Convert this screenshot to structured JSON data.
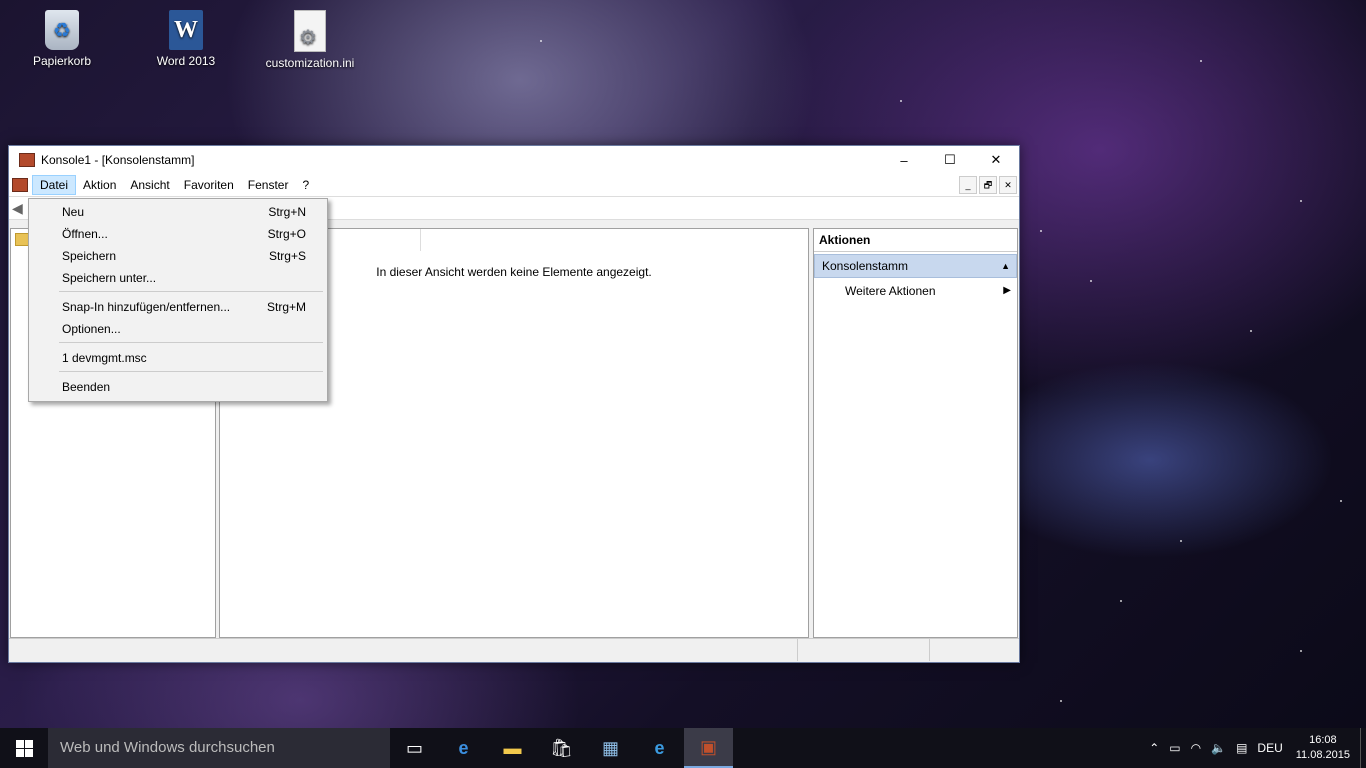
{
  "desktop": {
    "icons": [
      {
        "label": "Papierkorb"
      },
      {
        "label": "Word 2013"
      },
      {
        "label": "customization.ini"
      }
    ]
  },
  "window": {
    "title": "Konsole1 - [Konsolenstamm]",
    "controls": {
      "minimize": "–",
      "maximize": "☐",
      "close": "✕"
    },
    "menu": [
      "Datei",
      "Aktion",
      "Ansicht",
      "Favoriten",
      "Fenster",
      "?"
    ],
    "mdi_controls": {
      "minimize": "_",
      "restore": "🗗",
      "close": "✕"
    },
    "center": {
      "empty_message": "In dieser Ansicht werden keine Elemente angezeigt."
    },
    "actions": {
      "header": "Aktionen",
      "section": "Konsolenstamm",
      "item": "Weitere Aktionen"
    }
  },
  "file_menu": {
    "items": [
      {
        "label": "Neu",
        "shortcut": "Strg+N"
      },
      {
        "label": "Öffnen...",
        "shortcut": "Strg+O"
      },
      {
        "label": "Speichern",
        "shortcut": "Strg+S"
      },
      {
        "label": "Speichern unter...",
        "shortcut": ""
      },
      {
        "label": "Snap-In hinzufügen/entfernen...",
        "shortcut": "Strg+M"
      },
      {
        "label": "Optionen...",
        "shortcut": ""
      },
      {
        "label": "1 devmgmt.msc",
        "shortcut": ""
      },
      {
        "label": "Beenden",
        "shortcut": ""
      }
    ]
  },
  "taskbar": {
    "search_placeholder": "Web und Windows durchsuchen",
    "language": "DEU",
    "time": "16:08",
    "date": "11.08.2015"
  }
}
